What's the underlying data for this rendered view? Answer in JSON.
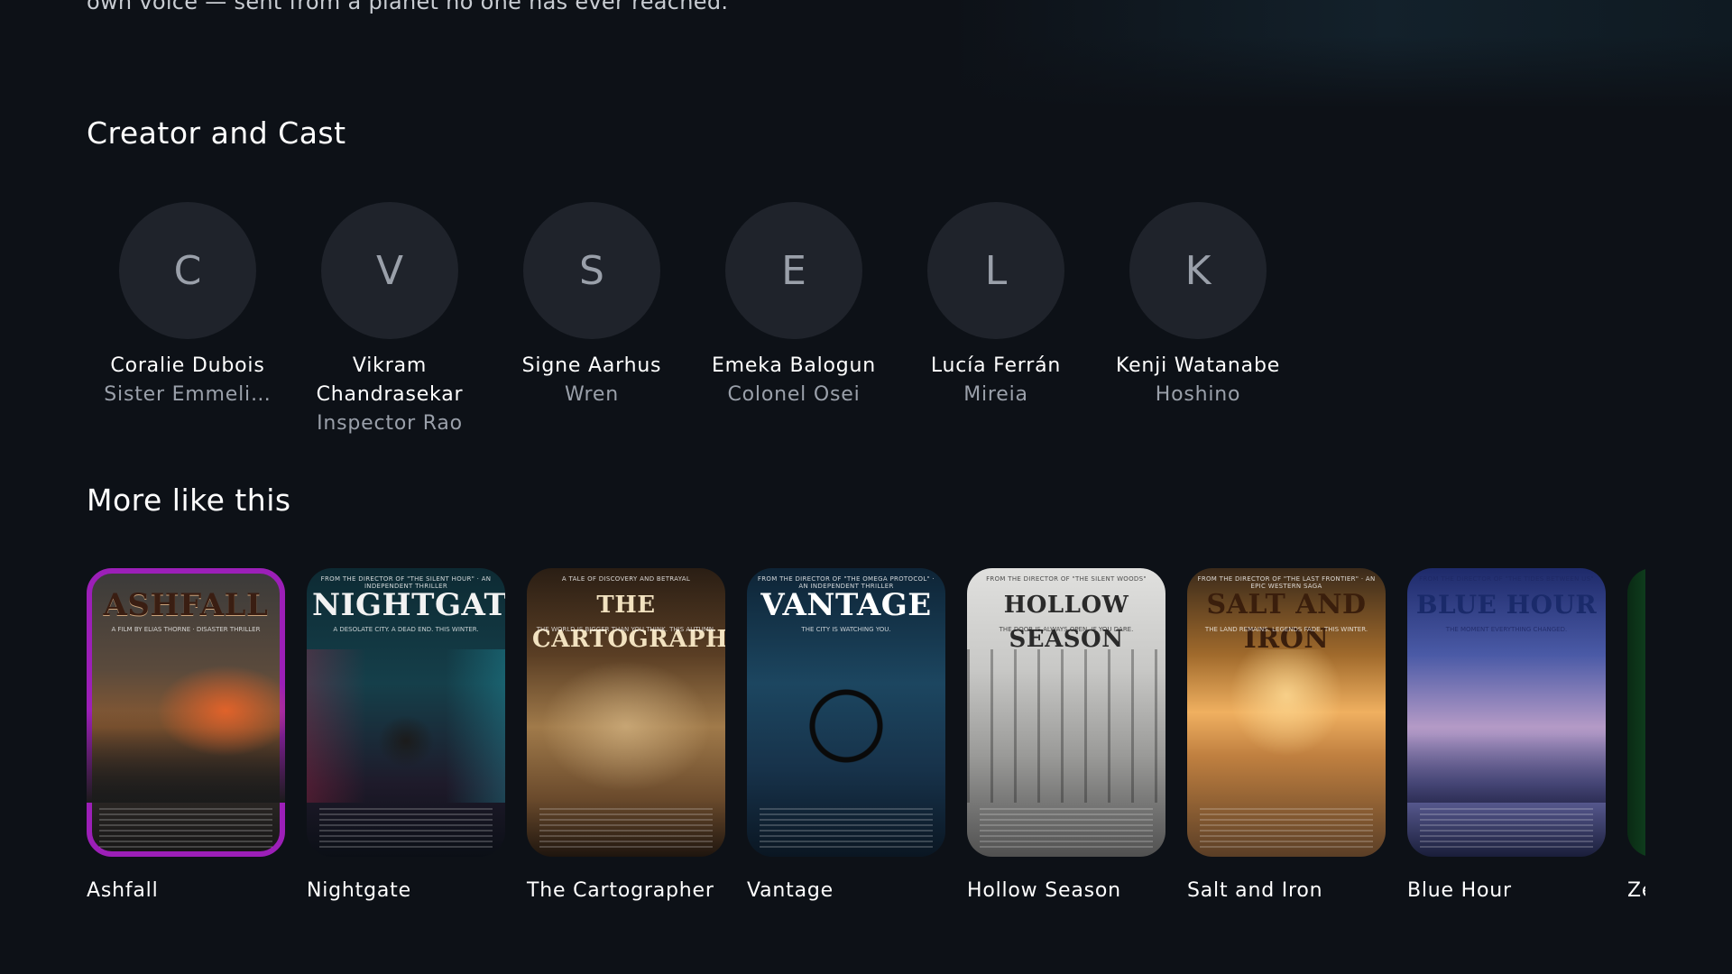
{
  "synopsis_tail": "own voice — sent from a planet no one has ever reached.",
  "cast_section": {
    "title": "Creator and Cast",
    "people": [
      {
        "initial": "C",
        "name": "Coralie Dubois",
        "role": "Sister Emmeli…"
      },
      {
        "initial": "V",
        "name": "Vikram Chandrasekar",
        "role": "Inspector Rao"
      },
      {
        "initial": "S",
        "name": "Signe Aarhus",
        "role": "Wren"
      },
      {
        "initial": "E",
        "name": "Emeka Balogun",
        "role": "Colonel Osei"
      },
      {
        "initial": "L",
        "name": "Lucía Ferrán",
        "role": "Mireia"
      },
      {
        "initial": "K",
        "name": "Kenji Watanabe",
        "role": "Hoshino"
      }
    ]
  },
  "more_section": {
    "title": "More like this",
    "titles": [
      {
        "title": "Ashfall",
        "poster_headline": "ASHFALL",
        "poster_tagline": "",
        "poster_sub": "A FILM BY ELIAS THORNE · DISASTER THRILLER",
        "focused": true
      },
      {
        "title": "Nightgate",
        "poster_headline": "NIGHTGATE",
        "poster_tagline": "FROM THE DIRECTOR OF \"THE SILENT HOUR\" · AN INDEPENDENT THRILLER",
        "poster_sub": "A DESOLATE CITY. A DEAD END. THIS WINTER.",
        "focused": false
      },
      {
        "title": "The Cartographer",
        "poster_headline": "THE CARTOGRAPHER",
        "poster_tagline": "A TALE OF DISCOVERY AND BETRAYAL",
        "poster_sub": "THE WORLD IS BIGGER THAN YOU THINK. THIS AUTUMN.",
        "focused": false
      },
      {
        "title": "Vantage",
        "poster_headline": "VANTAGE",
        "poster_tagline": "FROM THE DIRECTOR OF \"THE OMEGA PROTOCOL\" · AN INDEPENDENT THRILLER",
        "poster_sub": "THE CITY IS WATCHING YOU.",
        "focused": false
      },
      {
        "title": "Hollow Season",
        "poster_headline": "HOLLOW SEASON",
        "poster_tagline": "FROM THE DIRECTOR OF \"THE SILENT WOODS\"",
        "poster_sub": "THE DOOR IS ALWAYS OPEN. IF YOU DARE.",
        "focused": false
      },
      {
        "title": "Salt and Iron",
        "poster_headline": "SALT AND IRON",
        "poster_tagline": "FROM THE DIRECTOR OF \"THE LAST FRONTIER\" · AN EPIC WESTERN SAGA",
        "poster_sub": "THE LAND REMAINS. LEGENDS FADE. THIS WINTER.",
        "focused": false
      },
      {
        "title": "Blue Hour",
        "poster_headline": "BLUE HOUR",
        "poster_tagline": "FROM THE DIRECTOR OF \"THE TIDES BETWEEN US\"",
        "poster_sub": "THE MOMENT EVERYTHING CHANGED.",
        "focused": false
      },
      {
        "title": "Ze",
        "poster_headline": "",
        "poster_tagline": "",
        "poster_sub": "",
        "focused": false
      }
    ]
  },
  "colors": {
    "background": "#0d1117",
    "avatar_bg": "#1f232b",
    "focus_ring": "#9c1fb8",
    "secondary_text": "#9aa0aa"
  }
}
